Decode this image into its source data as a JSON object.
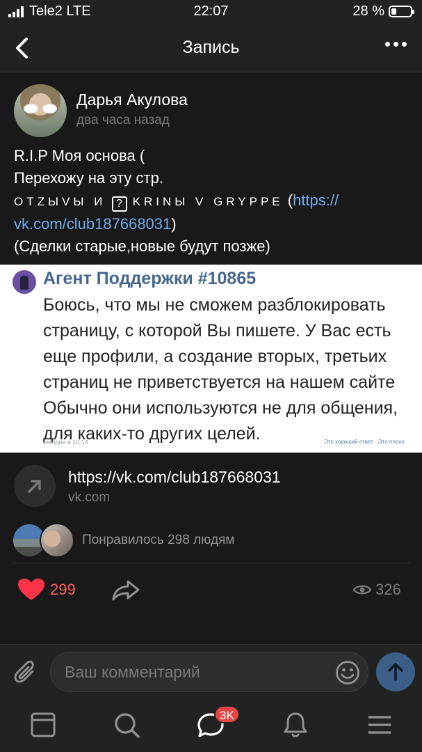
{
  "status_bar": {
    "carrier": "Tele2 LTE",
    "time": "22:07",
    "battery": "28 %",
    "battery_level": 0.28
  },
  "header": {
    "title": "Запись",
    "back_icon": "chevron-left-icon",
    "more_icon": "more-horizontal-icon"
  },
  "post": {
    "author": "Дарья Акулова",
    "time": "два часа назад",
    "text": {
      "line1": "R.I.P Моя основа (",
      "line2": "Перехожу на эту стр.",
      "line3_a": "OTZЫVЫ И",
      "line3_q": "?",
      "line3_b": "KRINЫ V GRYPPE",
      "line3_paren": "(",
      "line3_link": "https://",
      "line4_link": "vk.com/club187668031",
      "line4_end": ")",
      "line5": "(Сделки старые,новые будут позже)"
    }
  },
  "screenshot": {
    "sender": "Агент Поддержки #10865",
    "lines": [
      "Боюсь, что мы не сможем разблокировать",
      "страницу, с которой Вы пишете. У Вас есть",
      "еще профили, а создание вторых, третьих",
      "страниц не приветствуется на нашем сайте",
      "Обычно они используются не для общения,",
      "для каких-то других целей."
    ],
    "time": "сегодня в 10:14",
    "actions": "Это хороший ответ · Это плохо"
  },
  "link": {
    "url": "https://vk.com/club187668031",
    "domain": "vk.com",
    "icon": "arrow-up-right-icon"
  },
  "likers": {
    "text": "Понравилось 298 людям"
  },
  "actions": {
    "likes": "299",
    "views": "326",
    "like_color": "#ff3347"
  },
  "comment": {
    "placeholder": "Ваш комментарий"
  },
  "tab_bar": {
    "badge": "3K",
    "tabs": [
      "news-icon",
      "search-icon",
      "messages-icon",
      "notifications-icon",
      "menu-icon"
    ]
  },
  "colors": {
    "background": "#19191a",
    "accent": "#71aaeb",
    "send": "#3b5f88"
  }
}
